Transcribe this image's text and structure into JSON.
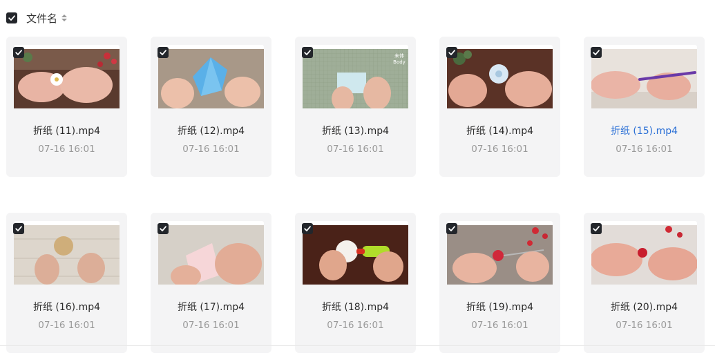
{
  "header": {
    "select_all_checked": true,
    "column_label": "文件名"
  },
  "files": [
    {
      "name": "折纸 (11).mp4",
      "date": "07-16 16:01"
    },
    {
      "name": "折纸 (12).mp4",
      "date": "07-16 16:01"
    },
    {
      "name": "折纸 (13).mp4",
      "date": "07-16 16:01"
    },
    {
      "name": "折纸 (14).mp4",
      "date": "07-16 16:01"
    },
    {
      "name": "折纸 (15).mp4",
      "date": "07-16 16:01"
    },
    {
      "name": "折纸 (16).mp4",
      "date": "07-16 16:01"
    },
    {
      "name": "折纸 (17).mp4",
      "date": "07-16 16:01"
    },
    {
      "name": "折纸 (18).mp4",
      "date": "07-16 16:01"
    },
    {
      "name": "折纸 (19).mp4",
      "date": "07-16 16:01"
    },
    {
      "name": "折纸 (20).mp4",
      "date": "07-16 16:01"
    }
  ],
  "thumb13_watermark": {
    "top": "未体",
    "bottom": "Body"
  },
  "colors": {
    "checkbox": "#23262b",
    "link": "#2a6fd6",
    "card_bg": "#f4f4f5",
    "date": "#9a9a9a"
  }
}
